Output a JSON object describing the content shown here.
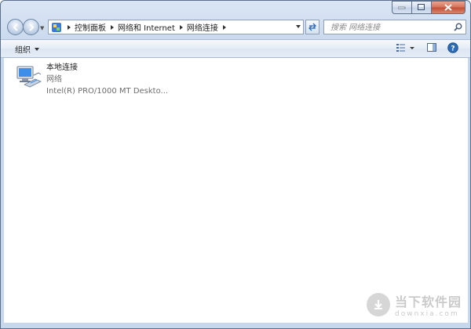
{
  "window": {
    "caption_buttons": [
      "minimize",
      "maximize",
      "close"
    ]
  },
  "address_bar": {
    "breadcrumbs": [
      "控制面板",
      "网络和 Internet",
      "网络连接"
    ]
  },
  "search": {
    "placeholder": "搜索 网络连接"
  },
  "toolbar": {
    "organize_label": "组织"
  },
  "connections": [
    {
      "name": "本地连接",
      "status": "网络",
      "adapter": "Intel(R) PRO/1000 MT Deskto..."
    }
  ],
  "watermark": {
    "title": "当下软件园",
    "url": "downxia.com"
  },
  "colors": {
    "frame": "#c7d7ec",
    "accent": "#2e6bb6",
    "close_button": "#c24b30"
  }
}
